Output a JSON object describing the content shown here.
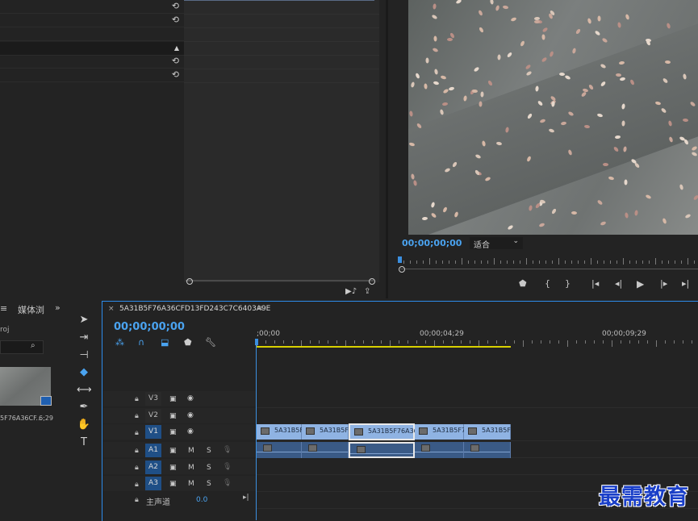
{
  "effect_controls": {
    "reset_icon": "reset-icon",
    "rows": [
      "",
      "",
      "",
      "",
      "",
      ""
    ]
  },
  "program_monitor": {
    "timecode": "00;00;00;00",
    "fit_label": "适合",
    "transport": [
      "marker-icon",
      "mark-in-icon",
      "mark-out-icon",
      "go-to-in-icon",
      "step-back-icon",
      "play-icon",
      "step-forward-icon",
      "go-to-out-icon"
    ]
  },
  "project": {
    "tab_label": "媒体浏",
    "more_label": "»",
    "project_name": "roj",
    "clip_name": "5F76A36CF...",
    "clip_duration": "6;29"
  },
  "timeline": {
    "sequence_name": "5A31B5F76A36CFD13FD243C7C6403A9E",
    "timecode": "00;00;00;00",
    "ruler_labels": [
      ";00;00",
      "00;00;04;29",
      "00;00;09;29"
    ],
    "tracks": {
      "video": [
        {
          "name": "V3",
          "active": false
        },
        {
          "name": "V2",
          "active": false
        },
        {
          "name": "V1",
          "active": true
        }
      ],
      "audio": [
        {
          "name": "A1",
          "active": true
        },
        {
          "name": "A2",
          "active": true
        },
        {
          "name": "A3",
          "active": true
        }
      ],
      "mute": "M",
      "solo": "S",
      "master_label": "主声道",
      "master_value": "0.0"
    },
    "clips": [
      "5A31B5F",
      "5A31B5F",
      "5A31B5F76A36",
      "5A31B5F7",
      "5A31B5F"
    ]
  },
  "watermark": "最需教育",
  "colors": {
    "accent": "#2d8ceb",
    "timecode": "#4aa3f0",
    "workarea": "#d8d000",
    "clip_video": "#8fb3e3",
    "clip_audio": "#3a5a86"
  }
}
